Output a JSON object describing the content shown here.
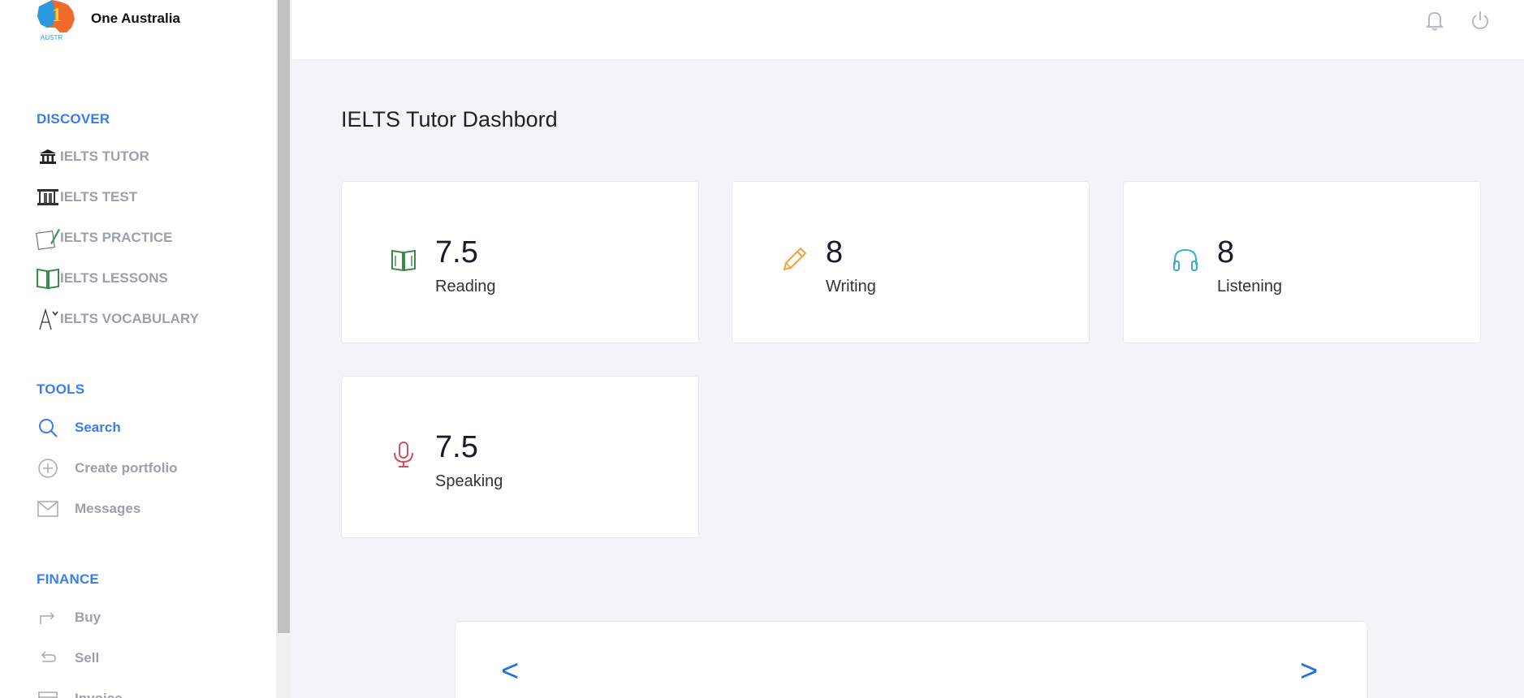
{
  "brand": {
    "name": "One Australia",
    "logo_text": "AUSTR"
  },
  "sidebar": {
    "discover": {
      "title": "DISCOVER",
      "items": [
        {
          "label": "IELTS TUTOR",
          "icon": "bank-icon"
        },
        {
          "label": "IELTS TEST",
          "icon": "test-icon"
        },
        {
          "label": "IELTS PRACTICE",
          "icon": "notepad-icon"
        },
        {
          "label": "IELTS LESSONS",
          "icon": "book-icon"
        },
        {
          "label": "IELTS VOCABULARY",
          "icon": "vocabulary-icon"
        }
      ]
    },
    "tools": {
      "title": "TOOLS",
      "items": [
        {
          "label": "Search",
          "icon": "search-icon",
          "active": true
        },
        {
          "label": "Create portfolio",
          "icon": "plus-circle-icon"
        },
        {
          "label": "Messages",
          "icon": "mail-icon"
        }
      ]
    },
    "finance": {
      "title": "FINANCE",
      "items": [
        {
          "label": "Buy",
          "icon": "forward-arrow-icon"
        },
        {
          "label": "Sell",
          "icon": "back-arrow-icon"
        },
        {
          "label": "Invoice",
          "icon": "calendar-icon"
        }
      ]
    }
  },
  "header": {
    "icons": [
      "bell-icon",
      "power-icon"
    ]
  },
  "main": {
    "title": "IELTS Tutor Dashbord",
    "cards": [
      {
        "score": "7.5",
        "skill": "Reading",
        "icon": "book-icon",
        "color": "#3a8a4a"
      },
      {
        "score": "8",
        "skill": "Writing",
        "icon": "pencil-icon",
        "color": "#f0a040"
      },
      {
        "score": "8",
        "skill": "Listening",
        "icon": "headphones-icon",
        "color": "#3ab0c8"
      },
      {
        "score": "7.5",
        "skill": "Speaking",
        "icon": "microphone-icon",
        "color": "#d05060"
      }
    ],
    "pager": {
      "prev": "<",
      "next": ">"
    }
  },
  "colors": {
    "accent": "#3b7cf0",
    "muted": "#9ca0a8",
    "background": "#f4f4f8"
  }
}
